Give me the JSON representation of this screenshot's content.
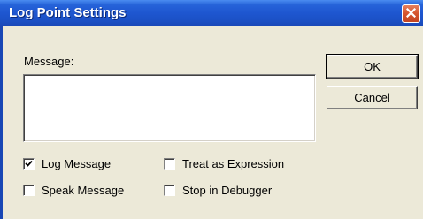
{
  "window": {
    "title": "Log Point Settings",
    "close_icon": "close-icon"
  },
  "form": {
    "message_label": "Message:",
    "message_value": ""
  },
  "buttons": {
    "ok_label": "OK",
    "cancel_label": "Cancel"
  },
  "options": [
    {
      "label": "Log Message",
      "checked": true
    },
    {
      "label": "Treat as Expression",
      "checked": false
    },
    {
      "label": "Speak Message",
      "checked": false
    },
    {
      "label": "Stop in Debugger",
      "checked": false
    }
  ],
  "colors": {
    "titlebar": "#1e56d0",
    "close_button": "#d4542d",
    "dialog_background": "#ece9d8"
  }
}
